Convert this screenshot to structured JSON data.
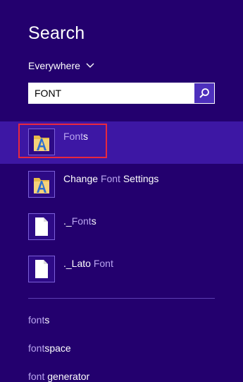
{
  "header": {
    "title": "Search"
  },
  "scope": {
    "label": "Everywhere"
  },
  "search": {
    "value": "FONT"
  },
  "results": [
    {
      "prefix": "",
      "match": "Font",
      "suffix": "s",
      "icon": "fonts-folder-icon"
    },
    {
      "prefix": "Change ",
      "match": "Font",
      "suffix": " Settings",
      "icon": "fonts-folder-icon"
    },
    {
      "prefix": "._",
      "match": "Font",
      "suffix": "s",
      "icon": "document-icon"
    },
    {
      "prefix": "._Lato ",
      "match": "Font",
      "suffix": "",
      "icon": "document-icon"
    }
  ],
  "suggestions": [
    {
      "typed": "font",
      "rest": "s"
    },
    {
      "typed": "font",
      "rest": "space"
    },
    {
      "typed": "font",
      "rest": " generator"
    }
  ],
  "colors": {
    "background": "#23006e",
    "selected": "#3d17a4",
    "highlight_border": "#e8283f",
    "search_button": "#4d2fbd"
  }
}
